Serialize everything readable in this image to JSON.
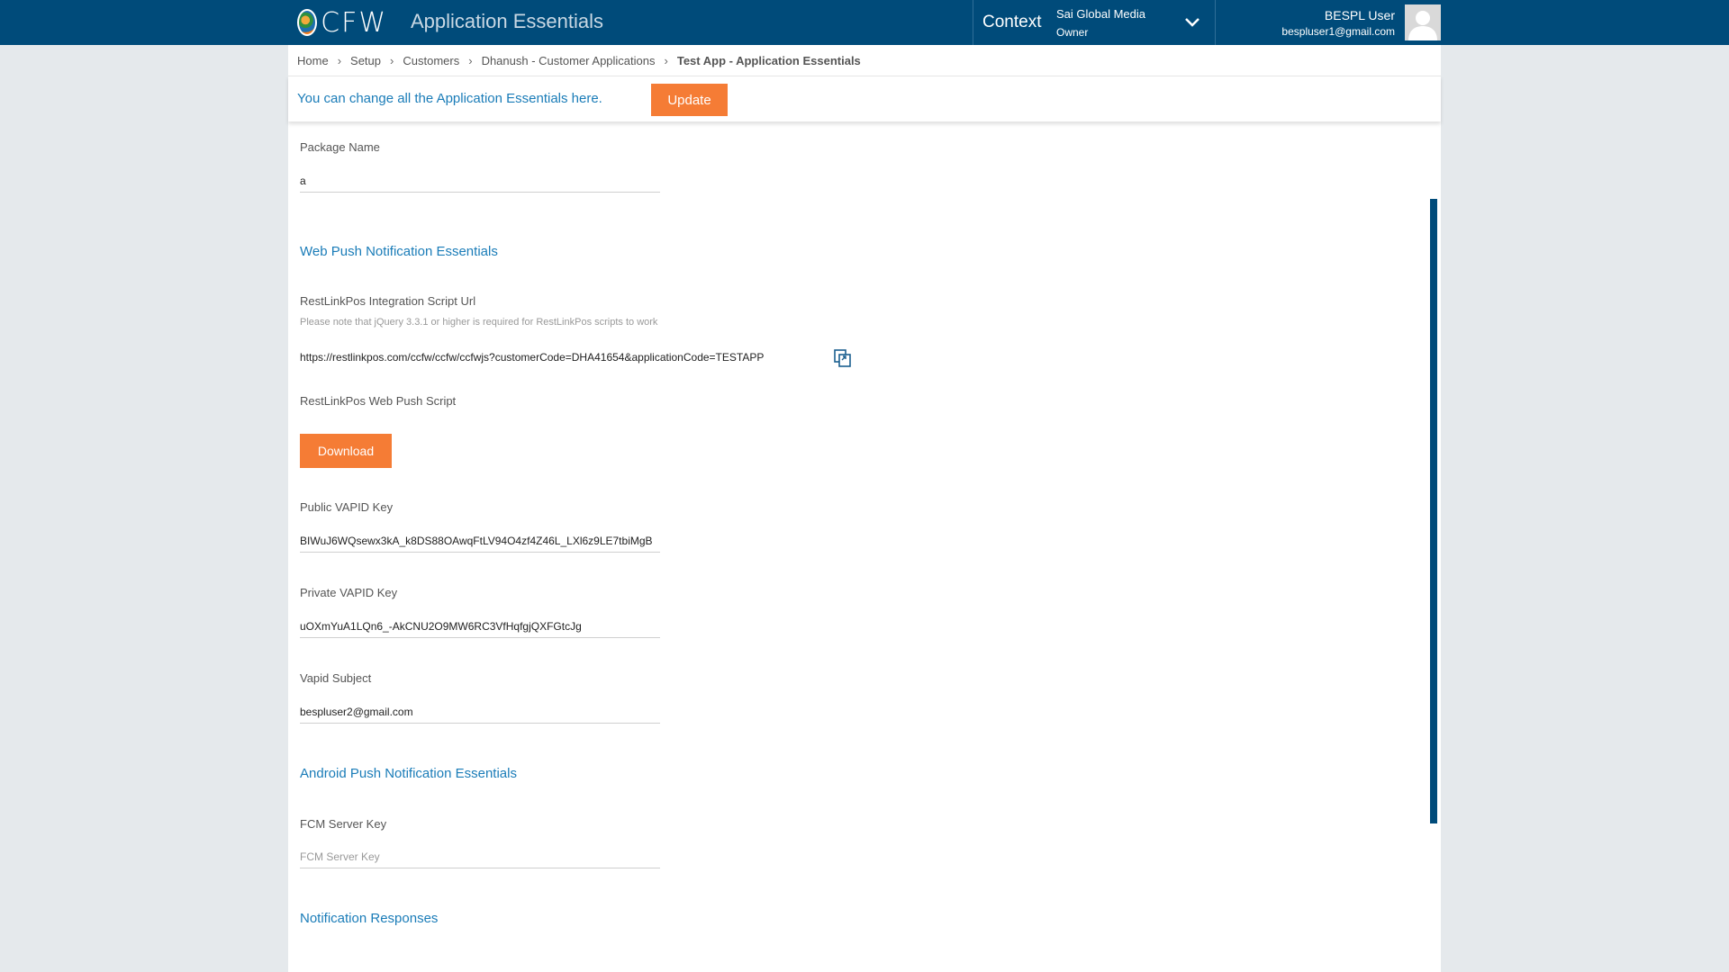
{
  "header": {
    "logo_text": "CFW",
    "app_title": "Application Essentials",
    "context_label": "Context",
    "context_org": "Sai Global Media",
    "context_role": "Owner",
    "user_name": "BESPL User",
    "user_email": "bespluser1@gmail.com"
  },
  "breadcrumb": [
    "Home",
    "Setup",
    "Customers",
    "Dhanush - Customer Applications",
    "Test App - Application Essentials"
  ],
  "info_bar": {
    "message": "You can change all the Application Essentials here.",
    "update_label": "Update"
  },
  "form": {
    "package_name_label": "Package Name",
    "package_name_value": "a",
    "web_push_title": "Web Push Notification Essentials",
    "script_url_label": "RestLinkPos Integration Script Url",
    "script_url_note": "Please note that jQuery 3.3.1 or higher is required for RestLinkPos scripts to work",
    "script_url_value": "https://restlinkpos.com/ccfw/ccfw/ccfwjs?customerCode=DHA41654&applicationCode=TESTAPP",
    "web_push_script_label": "RestLinkPos Web Push Script",
    "download_label": "Download",
    "public_vapid_label": "Public VAPID Key",
    "public_vapid_value": "BIWuJ6WQsewx3kA_k8DS88OAwqFtLV94O4zf4Z46L_LXl6z9LE7tbiMgB",
    "private_vapid_label": "Private VAPID Key",
    "private_vapid_value": "uOXmYuA1LQn6_-AkCNU2O9MW6RC3VfHqfgjQXFGtcJg",
    "vapid_subject_label": "Vapid Subject",
    "vapid_subject_value": "bespluser2@gmail.com",
    "android_push_title": "Android Push Notification Essentials",
    "fcm_label": "FCM Server Key",
    "fcm_placeholder": "FCM Server Key",
    "notification_responses_title": "Notification Responses"
  },
  "colors": {
    "header_bg": "#004b7a",
    "accent_orange": "#f57c35",
    "link_blue": "#1a7cb8"
  }
}
